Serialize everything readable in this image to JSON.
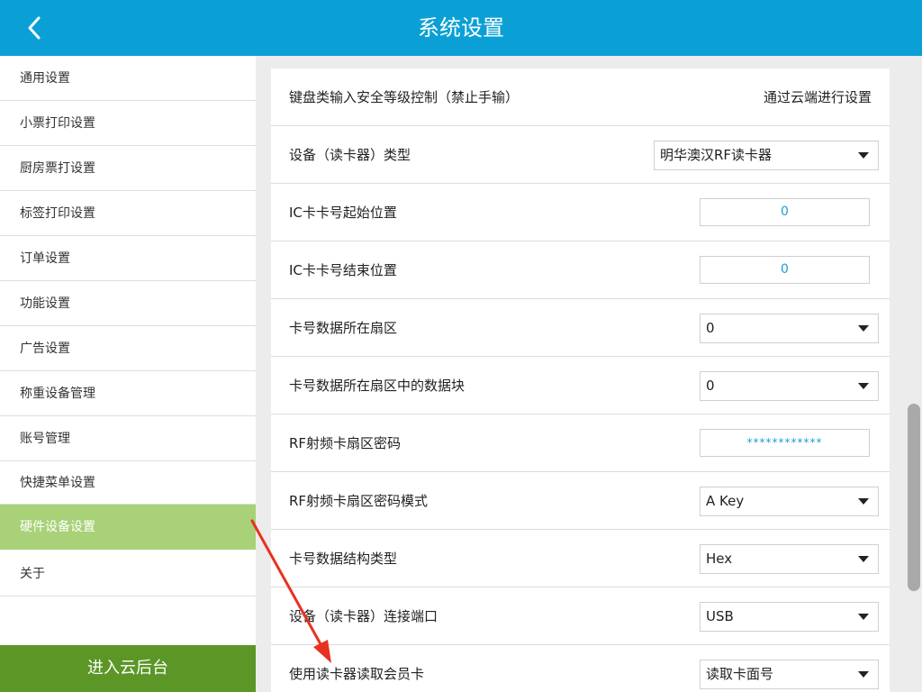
{
  "header": {
    "title": "系统设置"
  },
  "sidebar": {
    "items": [
      {
        "label": "通用设置"
      },
      {
        "label": "小票打印设置"
      },
      {
        "label": "厨房票打设置"
      },
      {
        "label": "标签打印设置"
      },
      {
        "label": "订单设置"
      },
      {
        "label": "功能设置"
      },
      {
        "label": "广告设置"
      },
      {
        "label": "称重设备管理"
      },
      {
        "label": "账号管理"
      },
      {
        "label": "快捷菜单设置"
      },
      {
        "label": "硬件设备设置",
        "active": true
      },
      {
        "label": "关于"
      }
    ],
    "cloud_button": "进入云后台"
  },
  "settings": {
    "rows": [
      {
        "label": "键盘类输入安全等级控制（禁止手输）",
        "type": "text",
        "value": "通过云端进行设置"
      },
      {
        "label": "设备（读卡器）类型",
        "type": "select",
        "value": "明华澳汉RF读卡器"
      },
      {
        "label": "IC卡卡号起始位置",
        "type": "input",
        "value": "0"
      },
      {
        "label": "IC卡卡号结束位置",
        "type": "input",
        "value": "0"
      },
      {
        "label": "卡号数据所在扇区",
        "type": "select",
        "value": "0"
      },
      {
        "label": "卡号数据所在扇区中的数据块",
        "type": "select",
        "value": "0"
      },
      {
        "label": "RF射频卡扇区密码",
        "type": "input",
        "value": "************"
      },
      {
        "label": "RF射频卡扇区密码模式",
        "type": "select",
        "value": "A Key"
      },
      {
        "label": "卡号数据结构类型",
        "type": "select",
        "value": "Hex"
      },
      {
        "label": "设备（读卡器）连接端口",
        "type": "select",
        "value": "USB"
      },
      {
        "label": "使用读卡器读取会员卡",
        "type": "select",
        "value": "读取卡面号"
      }
    ]
  },
  "colors": {
    "header": "#0aa0d6",
    "active_menu": "#a8d178",
    "cloud_button": "#5b9627",
    "input_text": "#1f9bd6",
    "annotation_arrow": "#e8321f"
  }
}
